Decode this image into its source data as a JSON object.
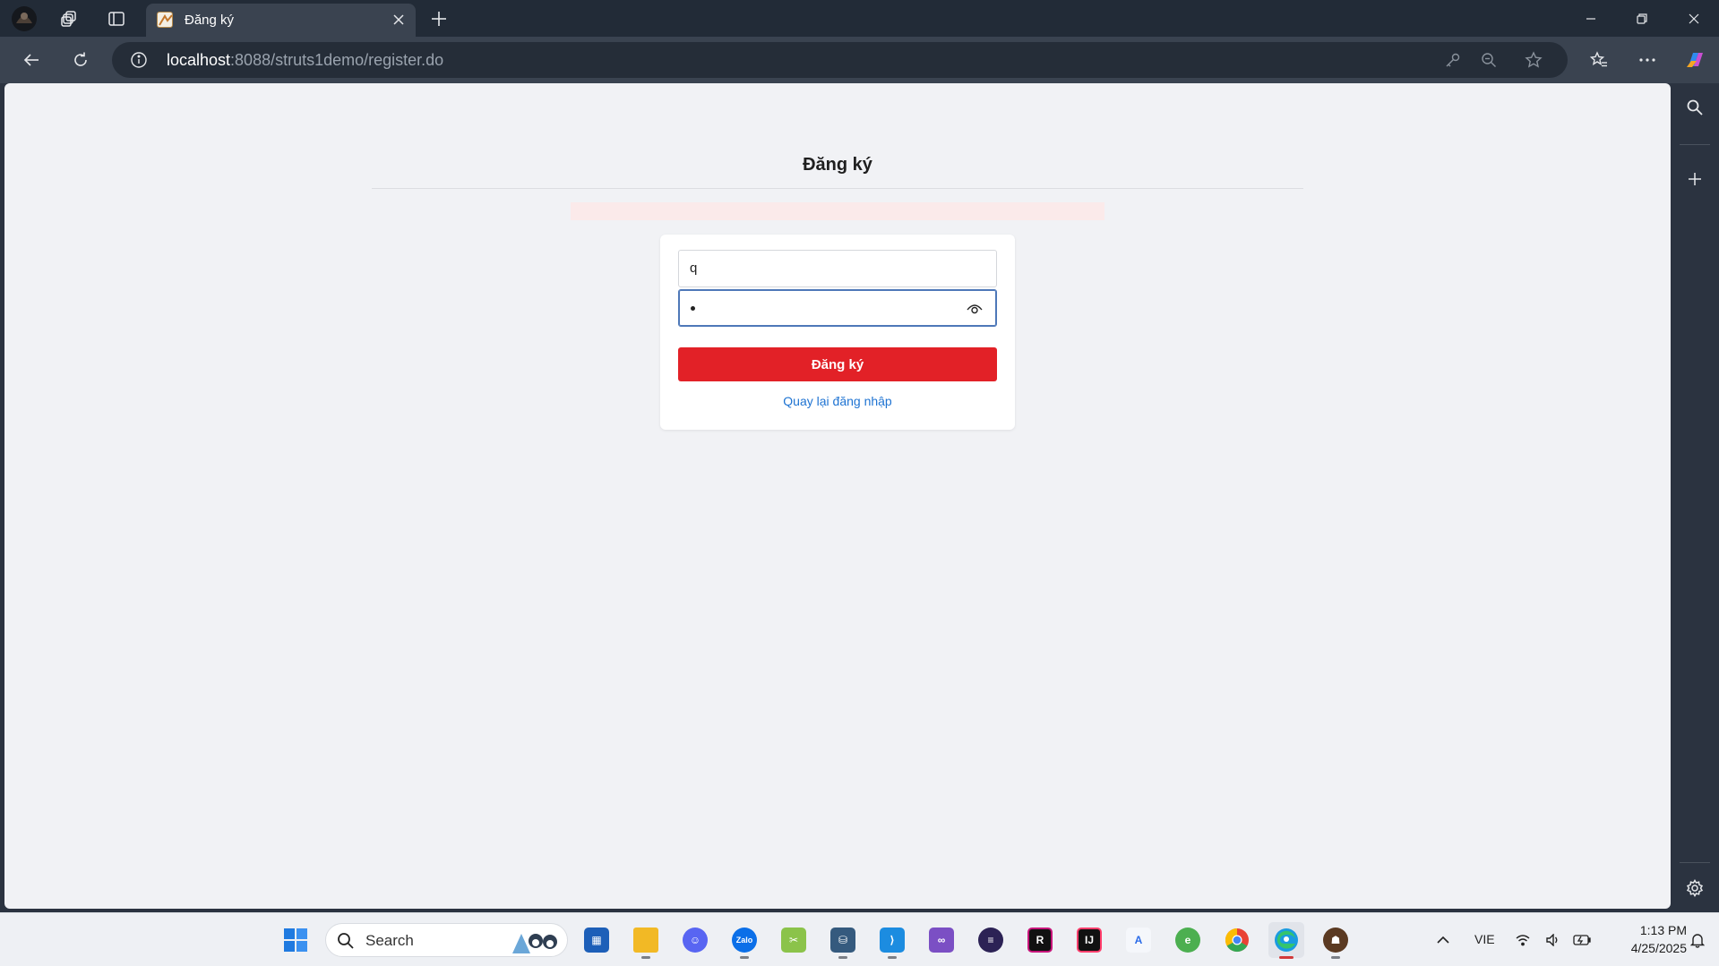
{
  "browser": {
    "tab": {
      "title": "Đăng ký"
    },
    "url": {
      "host": "localhost",
      "path": ":8088/struts1demo/register.do"
    }
  },
  "page": {
    "title": "Đăng ký",
    "form": {
      "username_value": "q",
      "password_masked": "•",
      "submit_label": "Đăng ký",
      "back_link_label": "Quay lại đăng nhập"
    }
  },
  "taskbar": {
    "search_placeholder": "Search",
    "apps": [
      "windows-start",
      "file-explorer",
      "microsoft-store",
      "files",
      "discord",
      "zalo",
      "snipping",
      "mysql-workbench",
      "vscode",
      "visual-studio",
      "eclipse",
      "jetbrains-rider",
      "intellij",
      "language-app",
      "edge-dev",
      "chrome",
      "edge",
      "game"
    ],
    "tray": {
      "language": "VIE",
      "time": "1:13 PM",
      "date": "4/25/2025"
    }
  },
  "colors": {
    "accent_red": "#e22127",
    "link_blue": "#1e73d2",
    "page_bg": "#f1f2f5",
    "browser_chrome": "#3a4350"
  }
}
